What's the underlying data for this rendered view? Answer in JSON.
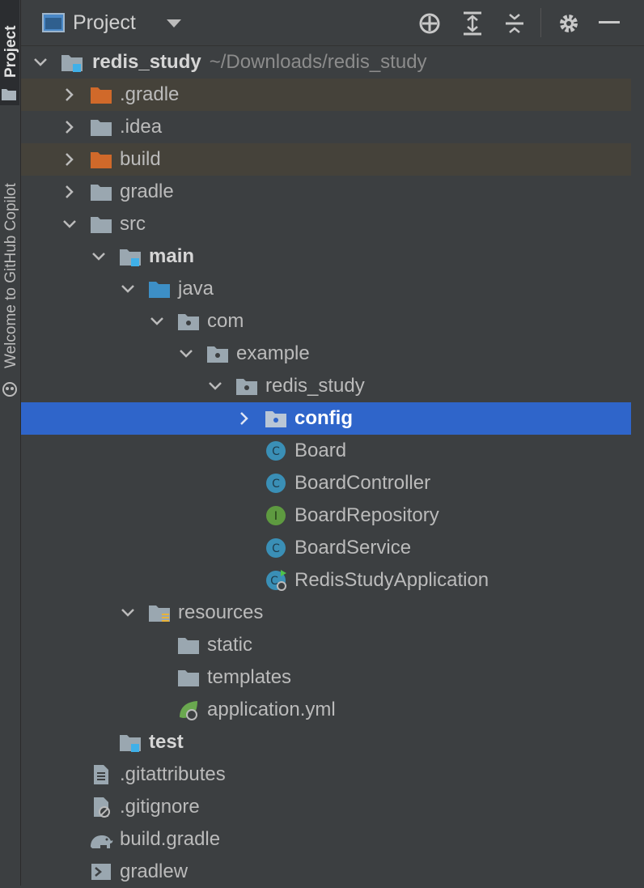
{
  "side_strip": {
    "project_tab": "Project",
    "copilot_tab": "Welcome to GitHub Copilot"
  },
  "header": {
    "title": "Project",
    "icons": [
      "project-view-icon",
      "dropdown-icon",
      "locate-icon",
      "expand-all-icon",
      "collapse-all-icon",
      "gear-icon",
      "minimize-icon"
    ]
  },
  "tree": {
    "root": {
      "name": "redis_study",
      "path": "~/Downloads/redis_study"
    },
    "items": [
      {
        "label": ".gradle",
        "icon": "folder-excluded-icon"
      },
      {
        "label": ".idea",
        "icon": "folder-icon"
      },
      {
        "label": "build",
        "icon": "folder-excluded-icon"
      },
      {
        "label": "gradle",
        "icon": "folder-icon"
      },
      {
        "label": "src",
        "icon": "folder-icon"
      },
      {
        "label": "main",
        "icon": "module-folder-icon"
      },
      {
        "label": "java",
        "icon": "source-folder-icon"
      },
      {
        "label": "com",
        "icon": "package-icon"
      },
      {
        "label": "example",
        "icon": "package-icon"
      },
      {
        "label": "redis_study",
        "icon": "package-icon"
      },
      {
        "label": "config",
        "icon": "package-icon"
      },
      {
        "label": "Board",
        "icon": "class-icon"
      },
      {
        "label": "BoardController",
        "icon": "class-icon"
      },
      {
        "label": "BoardRepository",
        "icon": "interface-icon"
      },
      {
        "label": "BoardService",
        "icon": "class-icon"
      },
      {
        "label": "RedisStudyApplication",
        "icon": "spring-boot-app-icon"
      },
      {
        "label": "resources",
        "icon": "resources-folder-icon"
      },
      {
        "label": "static",
        "icon": "folder-icon"
      },
      {
        "label": "templates",
        "icon": "folder-icon"
      },
      {
        "label": "application.yml",
        "icon": "spring-config-icon"
      },
      {
        "label": "test",
        "icon": "module-folder-icon"
      },
      {
        "label": ".gitattributes",
        "icon": "text-file-icon"
      },
      {
        "label": ".gitignore",
        "icon": "ignored-file-icon"
      },
      {
        "label": "build.gradle",
        "icon": "gradle-elephant-icon"
      },
      {
        "label": "gradlew",
        "icon": "shell-script-icon"
      }
    ],
    "selected": "config"
  },
  "colors": {
    "background": "#3c3f41",
    "selection": "#2f65ca",
    "excluded_row": "#45423a",
    "excluded_folder": "#d0692a",
    "folder": "#9aa7b0",
    "source_folder": "#3d8fc6",
    "class_icon": "#3a8fb6",
    "interface_icon": "#5e9a40",
    "module_marker": "#3fb0e8"
  }
}
